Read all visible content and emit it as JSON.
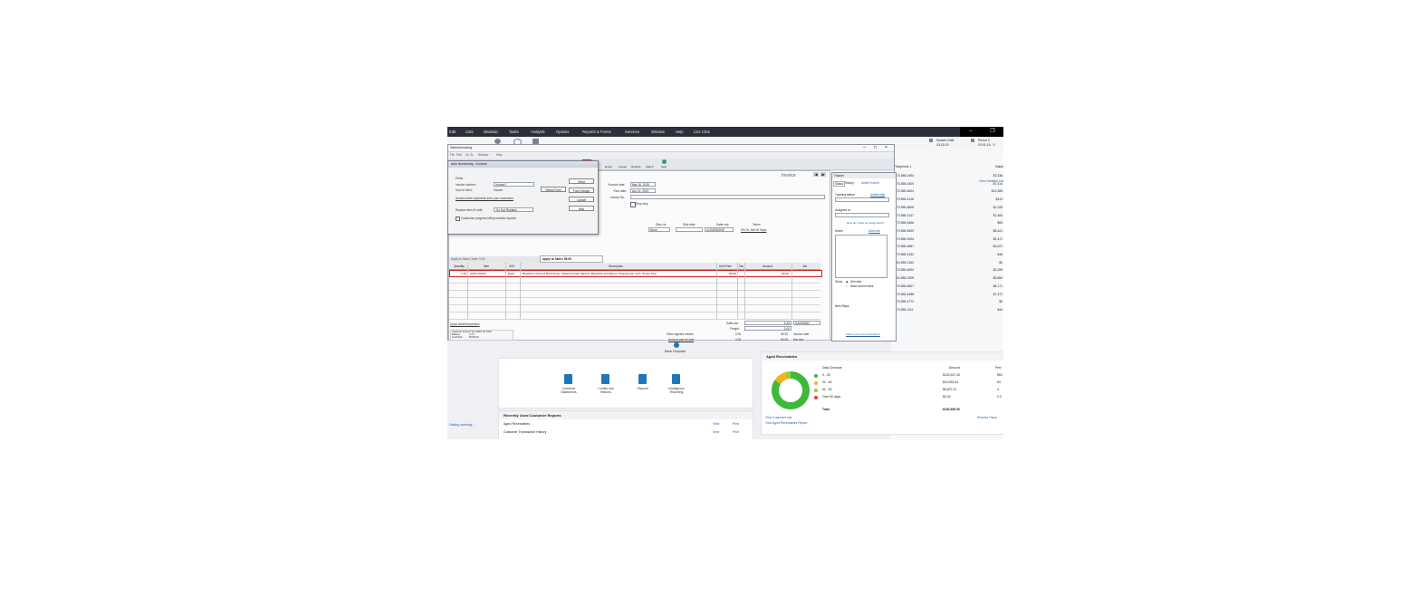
{
  "menubar": [
    "Edit",
    "Lists",
    "Maintain",
    "Tasks",
    "Analysis",
    "Options",
    "Reports & Forms",
    "Services",
    "Window",
    "Help",
    "Live Chat"
  ],
  "toolbar_buttons": [
    "Alerts",
    "Refresh",
    "Business"
  ],
  "header_right": {
    "system_date_label": "System Date",
    "system_date": "03-15-19",
    "period_label": "Period 3",
    "period_range": "03-01-19 - 0"
  },
  "invoice": {
    "window_title": "Sales/Invoicing",
    "menu": [
      "File",
      "Edit",
      "Go To",
      "Window",
      "Help"
    ],
    "toolbar": [
      "Email",
      "Layout",
      "Reports",
      "Attach",
      "Help"
    ],
    "heading": "Invoice",
    "invoice_date_label": "*Invoice date:",
    "invoice_date": "Mar 15, 2019",
    "due_date_label": "*Due date:",
    "due_date": "Apr 14, 2019",
    "invoice_no_label": "Invoice No.:",
    "drop_ship": "Drop ship",
    "shipvia_label": "Ship via",
    "ship_date_label": "Ship date",
    "sales_rep_label": "Sales rep",
    "terms_label": "Terms",
    "shipvia": "None",
    "sales_rep": "CLEARDONE",
    "terms": "2% 10, Net 30 Days",
    "tab_left": "Apply to Sales Order: 0.00",
    "tab_active": "Apply to Sales: 89.99",
    "columns": [
      "Quantity",
      "Item",
      "U/M",
      "Description",
      "Unit Price",
      "Tax",
      "Amount",
      "Job"
    ],
    "line": {
      "qty": "1.00",
      "item": "AVRY-20120",
      "um": "Each",
      "desc": "Bluebird 1.0 Koyoi Bird House, Attracts Purple Martins, Bluebirds and Wrens.  Polyvinyl air, 12 ft. House Pole.",
      "price": "89.99",
      "amount": "89.99"
    },
    "apply_link": "Apply tickets/expenses",
    "account_title": "Customer Account as of Mar 15, 2019",
    "balance_label": "Balance:",
    "balance": "$1.00",
    "credit_limit_label": "Credit limit:",
    "credit_limit": "$5,000.00",
    "credit_status_label": "Credit status:",
    "credit_status": "Notify Over Limit",
    "sales_tax_label": "Sales tax",
    "sales_tax": "5.40",
    "tax_code": "GAGWINN",
    "freight_label": "Freight",
    "freight": "0.00",
    "other_credits_label": "Other applied credits",
    "other_credits": "0.00",
    "invoice_total": "95.39",
    "invoice_total_label": "Invoice total",
    "amount_paid_link": "Amount paid at sale",
    "amount_paid": "0.00",
    "net_due": "95.39",
    "net_due_label": "Net due"
  },
  "dialog": {
    "title": "Auto Numbering - Invoices",
    "prefix_label": "Prefix",
    "invoice_number_label": "Invoice number:",
    "invoice_number": "InVoice7",
    "use_next_label": "Use for Next:",
    "use_next": "Invoice",
    "link_text": "Accept online payments from your customers",
    "replace_label": "Replace Item ID with:",
    "replace_value": "-Do Not Replace-",
    "checkbox_label": "Customize progress billing invoices layouts",
    "select_form": "Select Form",
    "buttons": [
      "Send",
      "Form Design",
      "Cancel",
      "Help"
    ]
  },
  "tracker": {
    "title": "Tracker",
    "tabs": [
      "Status",
      "History"
    ],
    "track_link": "Unlink Track It",
    "tracking_status": "Tracking status:",
    "add_modify": "Add/modify",
    "assigned_to": "Assigned to:",
    "how_link": "How do I track an assignment?",
    "notes": "Notes:",
    "add_note": "Add note",
    "show_label": "Show:",
    "all_notes": "All notes",
    "recent_notes": "Most recent notes",
    "next_steps": "Next Steps",
    "footer_link": "Add to your communications"
  },
  "customers": {
    "view_link": "View Detailed List",
    "telephone_header": "Telephone 1",
    "balance_header": "Balan",
    "rows": [
      [
        "770-555-0494",
        "$3,336."
      ],
      [
        "770-555-4400",
        "$7,414."
      ],
      [
        "770-555-6624",
        "$12,385."
      ],
      [
        "770-555-4118",
        "$412."
      ],
      [
        "770-555-6606",
        "$1,226."
      ],
      [
        "770-555-1147",
        "$1,460."
      ],
      [
        "770-555-4466",
        "$53."
      ],
      [
        "770-555-6490",
        "$8,421."
      ],
      [
        "770-555-0004",
        "$2,417."
      ],
      [
        "770-555-4867",
        "$4,621."
      ],
      [
        "770-555-4152",
        "$46."
      ],
      [
        "404-555-1163",
        "$0."
      ],
      [
        "770-555-6004",
        "$2,259."
      ],
      [
        "404-555-2205",
        "$5,882."
      ],
      [
        "770-555-6507",
        "$8,171."
      ],
      [
        "770-555-4488",
        "$7,317."
      ],
      [
        "770-555-4772",
        "$0."
      ],
      [
        "770-555-1111",
        "$44."
      ]
    ]
  },
  "dashboard": {
    "bank_deposits": "Bank Deposits",
    "icons": [
      "Customer Statements",
      "Credits and Returns",
      "Reports",
      "Intelligence Reporting"
    ],
    "recent_title": "Recently Used Customer Reports",
    "recent": [
      [
        "Aged Receivables",
        "View",
        "Print"
      ],
      [
        "Customer Transaction History",
        "View",
        "Print"
      ]
    ],
    "aged_title": "Aged Receivables",
    "days_overdue": "Days Overdue",
    "amount_header": "Amount",
    "pct_header": "Perc",
    "aged_rows": [
      {
        "label": "0 - 30",
        "amount": "$153,537.45",
        "pct": "$53.",
        "color": "#3fb93a"
      },
      {
        "label": "31 - 60",
        "amount": "$20,533.04",
        "pct": "$3.",
        "color": "#f2b321"
      },
      {
        "label": "61 - 90",
        "amount": "$8,607.31",
        "pct": "4.",
        "color": "#9ccc3a"
      },
      {
        "label": "Over 90 days",
        "amount": "$0.00",
        "pct": "0.0",
        "color": "#e33b3b"
      }
    ],
    "total_label": "Total",
    "total": "$182,536.90",
    "view_list": "View Customer List",
    "view_aged": "View Aged Receivables Report",
    "receive_payment": "Receive Paym",
    "side_link": "Getting Invoicing..."
  }
}
